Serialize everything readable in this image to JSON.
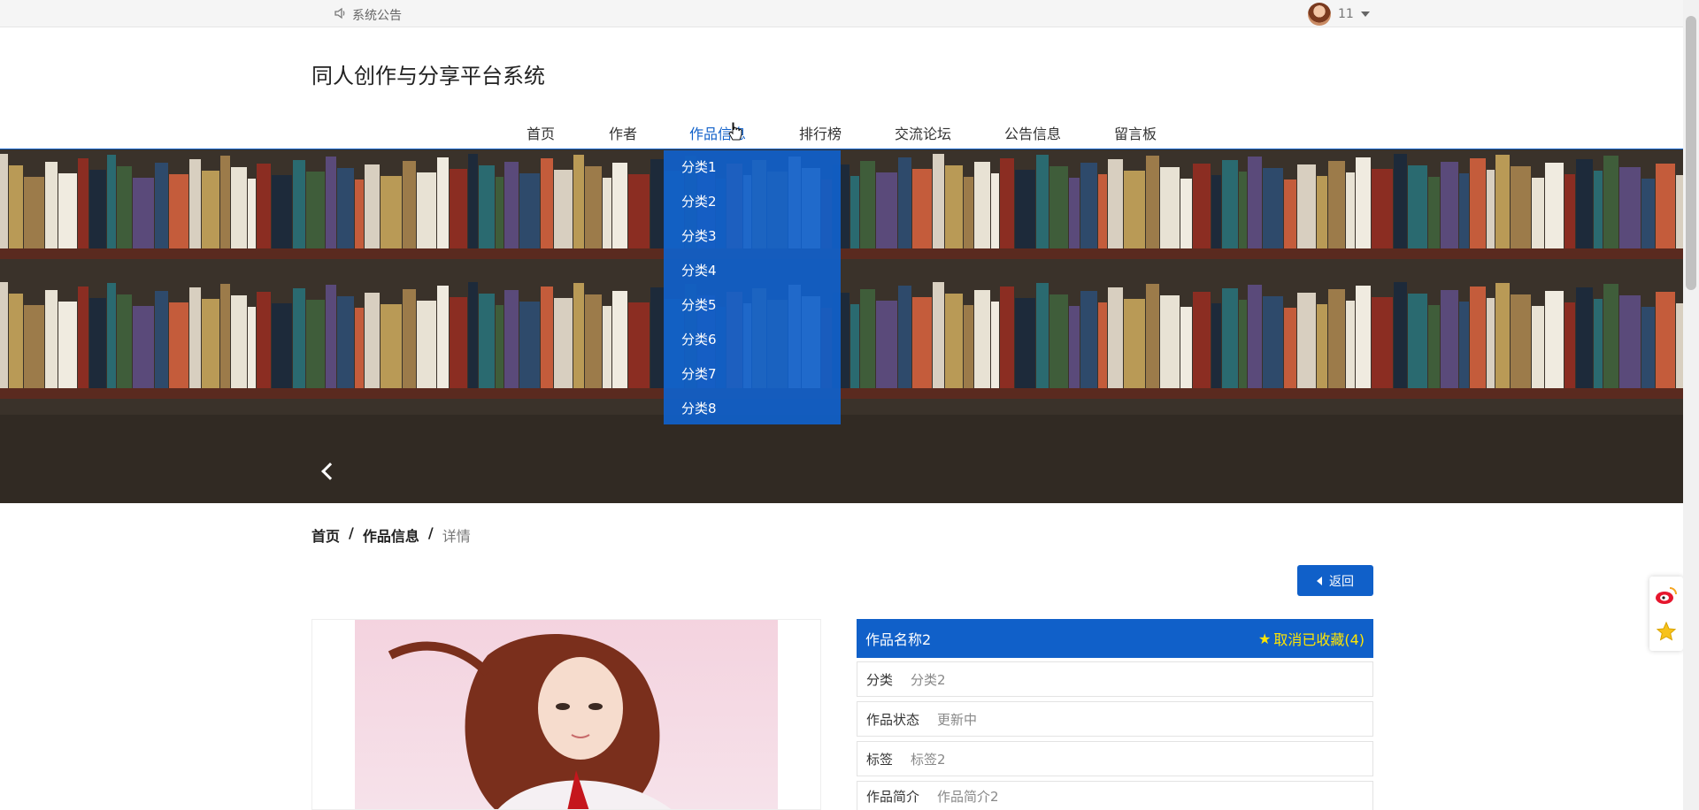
{
  "topbar": {
    "notice_label": "系统公告",
    "username": "11"
  },
  "site": {
    "title": "同人创作与分享平台系统"
  },
  "nav": {
    "items": [
      "首页",
      "作者",
      "作品信息",
      "排行榜",
      "交流论坛",
      "公告信息",
      "留言板"
    ],
    "active": "作品信息"
  },
  "dropdown": {
    "items": [
      "分类1",
      "分类2",
      "分类3",
      "分类4",
      "分类5",
      "分类6",
      "分类7",
      "分类8"
    ]
  },
  "carousel": {
    "slide_count": 3,
    "active_index": 2
  },
  "breadcrumb": {
    "home": "首页",
    "section": "作品信息",
    "current": "详情"
  },
  "back_button": {
    "label": "返回"
  },
  "detail": {
    "title": "作品名称2",
    "favorite_label": "取消已收藏(4)",
    "rows": [
      {
        "key": "分类",
        "value": "分类2"
      },
      {
        "key": "作品状态",
        "value": "更新中"
      },
      {
        "key": "标签",
        "value": "标签2"
      },
      {
        "key": "作品简介",
        "value": "作品简介2"
      }
    ]
  },
  "colors": {
    "primary": "#1060c9",
    "favorite": "#ffe600"
  }
}
